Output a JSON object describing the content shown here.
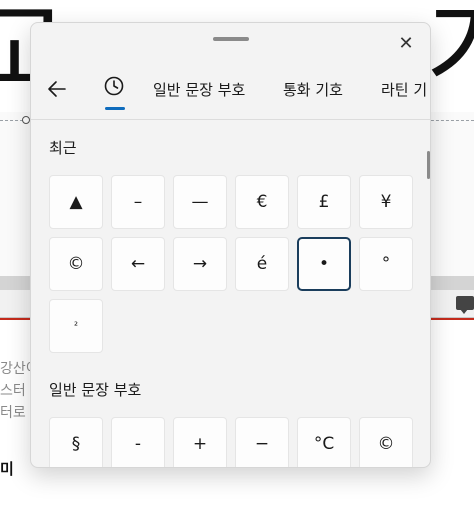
{
  "background_doc": {
    "heading_left": "고",
    "heading_right": "가",
    "lines": [
      "강산이",
      "스터",
      "터로",
      "미"
    ]
  },
  "panel": {
    "close_label": "✕",
    "tabs": {
      "back_icon": "back-arrow-icon",
      "recent_icon": "clock-icon",
      "items": [
        "일반 문장 부호",
        "통화 기호",
        "라틴 기"
      ]
    },
    "sections": {
      "recent": {
        "title": "최근",
        "symbols": [
          "▲",
          "–",
          "—",
          "€",
          "£",
          "¥",
          "©",
          "←",
          "→",
          "é",
          "•",
          "°",
          "²"
        ],
        "selected_index": 10
      },
      "general": {
        "title": "일반 문장 부호",
        "symbols": [
          "§",
          "-",
          "+",
          "−",
          "°C",
          "©"
        ]
      }
    }
  },
  "colors": {
    "accent": "#0f6cbd",
    "selected_border": "#1a3d5c",
    "doc_red_line": "#c42b1c"
  }
}
